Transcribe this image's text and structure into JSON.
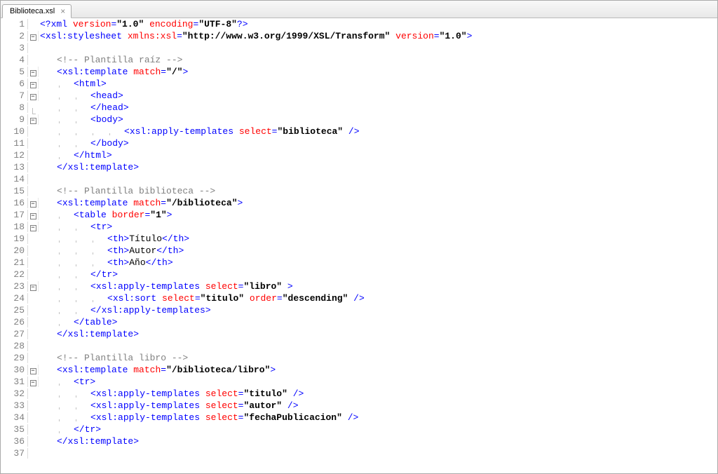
{
  "tab": {
    "title": "Biblioteca.xsl",
    "close": "×"
  },
  "fold_minus": "−",
  "lines": [
    {
      "n": 1,
      "fold": "",
      "indent": 0,
      "guides": [],
      "html": "<span class='pi'>&lt;?</span><span class='tag'>xml</span> <span class='attr'>version</span><span class='pi'>=</span><span class='str'>\"1.0\"</span> <span class='attr'>encoding</span><span class='pi'>=</span><span class='str'>\"UTF-8\"</span><span class='pi'>?&gt;</span>"
    },
    {
      "n": 2,
      "fold": "box",
      "indent": 0,
      "guides": [],
      "html": "<span class='tag-bracket'>&lt;</span><span class='tag'>xsl:stylesheet</span> <span class='attr'>xmlns:xsl</span><span class='tag-bracket'>=</span><span class='str'>\"http://www.w3.org/1999/XSL/Transform\"</span> <span class='attr'>version</span><span class='tag-bracket'>=</span><span class='str'>\"1.0\"</span><span class='tag-bracket'>&gt;</span>"
    },
    {
      "n": 3,
      "fold": "line",
      "indent": 0,
      "guides": [],
      "html": ""
    },
    {
      "n": 4,
      "fold": "line",
      "indent": 1,
      "guides": [],
      "html": "<span class='comment'>&lt;!-- Plantilla raíz --&gt;</span>"
    },
    {
      "n": 5,
      "fold": "box",
      "indent": 1,
      "guides": [],
      "html": "<span class='tag-bracket'>&lt;</span><span class='tag'>xsl:template</span> <span class='attr'>match</span><span class='tag-bracket'>=</span><span class='str'>\"/\"</span><span class='tag-bracket'>&gt;</span>"
    },
    {
      "n": 6,
      "fold": "box",
      "indent": 2,
      "guides": [
        1
      ],
      "html": "<span class='tag-bracket'>&lt;</span><span class='tag'>html</span><span class='tag-bracket'>&gt;</span>"
    },
    {
      "n": 7,
      "fold": "box",
      "indent": 3,
      "guides": [
        1,
        2
      ],
      "html": "<span class='tag-bracket'>&lt;</span><span class='tag'>head</span><span class='tag-bracket'>&gt;</span>"
    },
    {
      "n": 8,
      "fold": "end",
      "indent": 3,
      "guides": [
        1,
        2
      ],
      "html": "<span class='tag-bracket'>&lt;/</span><span class='tag'>head</span><span class='tag-bracket'>&gt;</span>"
    },
    {
      "n": 9,
      "fold": "box",
      "indent": 3,
      "guides": [
        1,
        2
      ],
      "html": "<span class='tag-bracket'>&lt;</span><span class='tag'>body</span><span class='tag-bracket'>&gt;</span>"
    },
    {
      "n": 10,
      "fold": "line",
      "indent": 5,
      "guides": [
        1,
        2,
        3,
        4
      ],
      "html": "<span class='tag-bracket'>&lt;</span><span class='tag'>xsl:apply-templates</span> <span class='attr'>select</span><span class='tag-bracket'>=</span><span class='str'>\"biblioteca\"</span> <span class='tag-bracket'>/&gt;</span>"
    },
    {
      "n": 11,
      "fold": "line",
      "indent": 3,
      "guides": [
        1,
        2
      ],
      "html": "<span class='tag-bracket'>&lt;/</span><span class='tag'>body</span><span class='tag-bracket'>&gt;</span>"
    },
    {
      "n": 12,
      "fold": "line",
      "indent": 2,
      "guides": [
        1
      ],
      "html": "<span class='tag-bracket'>&lt;/</span><span class='tag'>html</span><span class='tag-bracket'>&gt;</span>"
    },
    {
      "n": 13,
      "fold": "line",
      "indent": 1,
      "guides": [],
      "html": "<span class='tag-bracket'>&lt;/</span><span class='tag'>xsl:template</span><span class='tag-bracket'>&gt;</span>"
    },
    {
      "n": 14,
      "fold": "line",
      "indent": 0,
      "guides": [],
      "html": ""
    },
    {
      "n": 15,
      "fold": "line",
      "indent": 1,
      "guides": [],
      "html": "<span class='comment'>&lt;!-- Plantilla biblioteca --&gt;</span>"
    },
    {
      "n": 16,
      "fold": "box",
      "indent": 1,
      "guides": [],
      "html": "<span class='tag-bracket'>&lt;</span><span class='tag'>xsl:template</span> <span class='attr'>match</span><span class='tag-bracket'>=</span><span class='str'>\"/biblioteca\"</span><span class='tag-bracket'>&gt;</span>"
    },
    {
      "n": 17,
      "fold": "box",
      "indent": 2,
      "guides": [
        1
      ],
      "html": "<span class='tag-bracket'>&lt;</span><span class='tag'>table</span> <span class='attr'>border</span><span class='tag-bracket'>=</span><span class='str'>\"1\"</span><span class='tag-bracket'>&gt;</span>"
    },
    {
      "n": 18,
      "fold": "box",
      "indent": 3,
      "guides": [
        1,
        2
      ],
      "html": "<span class='tag-bracket'>&lt;</span><span class='tag'>tr</span><span class='tag-bracket'>&gt;</span>"
    },
    {
      "n": 19,
      "fold": "line",
      "indent": 4,
      "guides": [
        1,
        2,
        3
      ],
      "html": "<span class='tag-bracket'>&lt;</span><span class='tag'>th</span><span class='tag-bracket'>&gt;</span><span class='text'>Título</span><span class='tag-bracket'>&lt;/</span><span class='tag'>th</span><span class='tag-bracket'>&gt;</span>"
    },
    {
      "n": 20,
      "fold": "line",
      "indent": 4,
      "guides": [
        1,
        2,
        3
      ],
      "html": "<span class='tag-bracket'>&lt;</span><span class='tag'>th</span><span class='tag-bracket'>&gt;</span><span class='text'>Autor</span><span class='tag-bracket'>&lt;/</span><span class='tag'>th</span><span class='tag-bracket'>&gt;</span>"
    },
    {
      "n": 21,
      "fold": "line",
      "indent": 4,
      "guides": [
        1,
        2,
        3
      ],
      "html": "<span class='tag-bracket'>&lt;</span><span class='tag'>th</span><span class='tag-bracket'>&gt;</span><span class='text'>Año</span><span class='tag-bracket'>&lt;/</span><span class='tag'>th</span><span class='tag-bracket'>&gt;</span>"
    },
    {
      "n": 22,
      "fold": "line",
      "indent": 3,
      "guides": [
        1,
        2
      ],
      "html": "<span class='tag-bracket'>&lt;/</span><span class='tag'>tr</span><span class='tag-bracket'>&gt;</span>"
    },
    {
      "n": 23,
      "fold": "box",
      "indent": 3,
      "guides": [
        1,
        2
      ],
      "html": "<span class='tag-bracket'>&lt;</span><span class='tag'>xsl:apply-templates</span> <span class='attr'>select</span><span class='tag-bracket'>=</span><span class='str'>\"libro\"</span> <span class='tag-bracket'>&gt;</span>"
    },
    {
      "n": 24,
      "fold": "line",
      "indent": 4,
      "guides": [
        1,
        2,
        3
      ],
      "html": "<span class='tag-bracket'>&lt;</span><span class='tag'>xsl:sort</span> <span class='attr'>select</span><span class='tag-bracket'>=</span><span class='str'>\"titulo\"</span> <span class='attr'>order</span><span class='tag-bracket'>=</span><span class='str'>\"descending\"</span> <span class='tag-bracket'>/&gt;</span>"
    },
    {
      "n": 25,
      "fold": "line",
      "indent": 3,
      "guides": [
        1,
        2
      ],
      "html": "<span class='tag-bracket'>&lt;/</span><span class='tag'>xsl:apply-templates</span><span class='tag-bracket'>&gt;</span>"
    },
    {
      "n": 26,
      "fold": "line",
      "indent": 2,
      "guides": [
        1
      ],
      "html": "<span class='tag-bracket'>&lt;/</span><span class='tag'>table</span><span class='tag-bracket'>&gt;</span>"
    },
    {
      "n": 27,
      "fold": "line",
      "indent": 1,
      "guides": [],
      "html": "<span class='tag-bracket'>&lt;/</span><span class='tag'>xsl:template</span><span class='tag-bracket'>&gt;</span>"
    },
    {
      "n": 28,
      "fold": "line",
      "indent": 0,
      "guides": [],
      "html": ""
    },
    {
      "n": 29,
      "fold": "line",
      "indent": 1,
      "guides": [],
      "html": "<span class='comment'>&lt;!-- Plantilla libro --&gt;</span>"
    },
    {
      "n": 30,
      "fold": "box",
      "indent": 1,
      "guides": [],
      "html": "<span class='tag-bracket'>&lt;</span><span class='tag'>xsl:template</span> <span class='attr'>match</span><span class='tag-bracket'>=</span><span class='str'>\"/biblioteca/libro\"</span><span class='tag-bracket'>&gt;</span>"
    },
    {
      "n": 31,
      "fold": "box",
      "indent": 2,
      "guides": [
        1
      ],
      "html": "<span class='tag-bracket'>&lt;</span><span class='tag'>tr</span><span class='tag-bracket'>&gt;</span>"
    },
    {
      "n": 32,
      "fold": "line",
      "indent": 3,
      "guides": [
        1,
        2
      ],
      "html": "<span class='tag-bracket'>&lt;</span><span class='tag'>xsl:apply-templates</span> <span class='attr'>select</span><span class='tag-bracket'>=</span><span class='str'>\"titulo\"</span> <span class='tag-bracket'>/&gt;</span>"
    },
    {
      "n": 33,
      "fold": "line",
      "indent": 3,
      "guides": [
        1,
        2
      ],
      "html": "<span class='tag-bracket'>&lt;</span><span class='tag'>xsl:apply-templates</span> <span class='attr'>select</span><span class='tag-bracket'>=</span><span class='str'>\"autor\"</span> <span class='tag-bracket'>/&gt;</span>"
    },
    {
      "n": 34,
      "fold": "line",
      "indent": 3,
      "guides": [
        1,
        2
      ],
      "html": "<span class='tag-bracket'>&lt;</span><span class='tag'>xsl:apply-templates</span> <span class='attr'>select</span><span class='tag-bracket'>=</span><span class='str'>\"fechaPublicacion\"</span> <span class='tag-bracket'>/&gt;</span>"
    },
    {
      "n": 35,
      "fold": "line",
      "indent": 2,
      "guides": [
        1
      ],
      "html": "<span class='tag-bracket'>&lt;/</span><span class='tag'>tr</span><span class='tag-bracket'>&gt;</span>"
    },
    {
      "n": 36,
      "fold": "line",
      "indent": 1,
      "guides": [],
      "html": "<span class='tag-bracket'>&lt;/</span><span class='tag'>xsl:template</span><span class='tag-bracket'>&gt;</span>"
    },
    {
      "n": 37,
      "fold": "line",
      "indent": 0,
      "guides": [],
      "html": ""
    }
  ]
}
